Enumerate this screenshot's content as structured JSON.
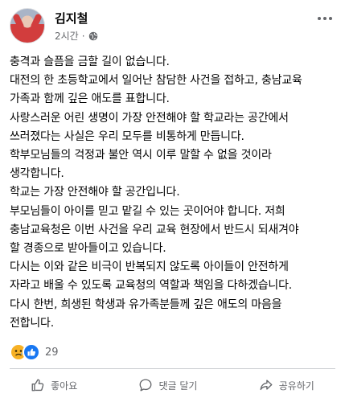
{
  "post": {
    "author": "김지철",
    "time": "2시간",
    "privacy_icon": "globe-icon",
    "more_icon": "more-options-icon",
    "paragraphs": [
      [
        "충격과 슬픔을 금할 길이 없습니다."
      ],
      [
        "대전의 한 초등학교에서 일어난 참담한 사건을 접하고, 충남교육",
        "가족과 함께 깊은 애도를 표합니다."
      ],
      [
        "사랑스러운 어린 생명이 가장 안전해야 할 학교라는 공간에서",
        "쓰러졌다는 사실은 우리 모두를 비통하게 만듭니다."
      ],
      [
        "학부모님들의 걱정과 불안 역시 이루 말할 수 없을 것이라",
        "생각합니다."
      ],
      [
        "학교는 가장 안전해야 할 공간입니다."
      ],
      [
        "부모님들이 아이를 믿고 맡길 수 있는 곳이어야 합니다. 저희",
        "충남교육청은 이번 사건을 우리 교육 현장에서 반드시 되새겨야",
        "할 경종으로 받아들이고 있습니다."
      ],
      [
        "다시는 이와 같은 비극이 반복되지 않도록 아이들이 안전하게",
        "자라고 배울 수 있도록 교육청의 역할과 책임을 다하겠습니다."
      ],
      [
        "다시 한번, 희생된 학생과 유가족분들께 깊은 애도의 마음을",
        "전합니다."
      ]
    ]
  },
  "reactions": {
    "icons": [
      "sad-reaction-icon",
      "like-reaction-icon"
    ],
    "count": "29"
  },
  "actions": {
    "like": "좋아요",
    "comment": "댓글 달기",
    "share": "공유하기"
  },
  "colors": {
    "like_blue": "#1877f2",
    "sad_yellow": "#f7b125",
    "meta_gray": "#65676b"
  }
}
